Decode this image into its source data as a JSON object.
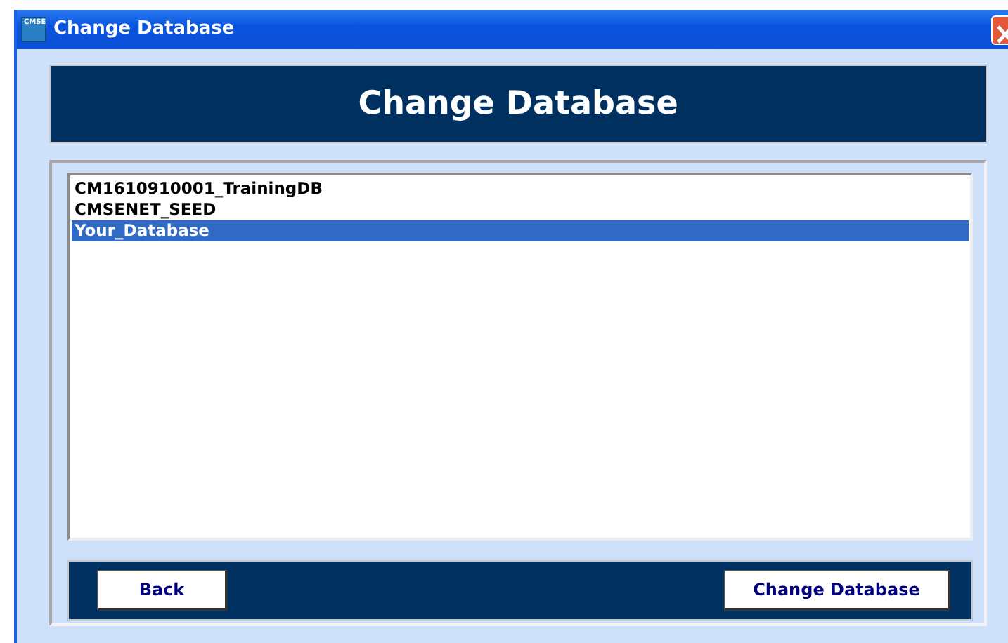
{
  "window": {
    "title": "Change Database",
    "icon_text": "CMSE"
  },
  "header": {
    "title": "Change Database"
  },
  "databases": [
    {
      "name": "CM1610910001_TrainingDB",
      "selected": false
    },
    {
      "name": "CMSENET_SEED",
      "selected": false
    },
    {
      "name": "Your_Database",
      "selected": true
    }
  ],
  "buttons": [
    {
      "label": "Back"
    },
    {
      "label": "Change Database"
    }
  ]
}
